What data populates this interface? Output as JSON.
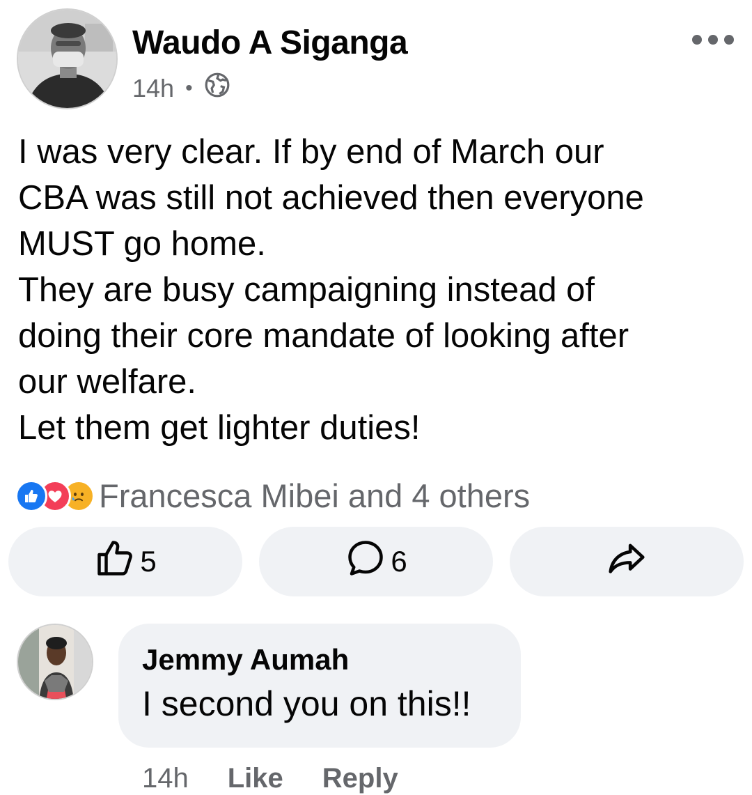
{
  "post": {
    "author": "Waudo A Siganga",
    "time": "14h",
    "separator": "•",
    "audience_icon": "globe-icon",
    "more_icon": "more-options-icon",
    "lines": [
      "I was very clear. If by end of March our",
      "CBA was still not achieved then everyone",
      "MUST go home.",
      "They are busy campaigning instead of",
      "doing their core mandate of looking after",
      "our welfare.",
      "Let them get lighter duties!"
    ]
  },
  "reactions": {
    "icons": [
      "like-reaction-icon",
      "love-reaction-icon",
      "sad-reaction-icon"
    ],
    "summary": "Francesca Mibei and 4 others"
  },
  "actions": {
    "like_count": "5",
    "comment_count": "6",
    "icons": [
      "thumbs-up-icon",
      "comment-icon",
      "share-icon"
    ]
  },
  "comment": {
    "author": "Jemmy Aumah",
    "text": "I second you on this!!",
    "time": "14h",
    "like_label": "Like",
    "reply_label": "Reply"
  },
  "colors": {
    "text": "#050505",
    "secondary": "#65676b",
    "button_bg": "#f0f2f5",
    "like_blue": "#1877f2",
    "love_red": "#f33e58",
    "sad_yellow": "#f7b125"
  }
}
